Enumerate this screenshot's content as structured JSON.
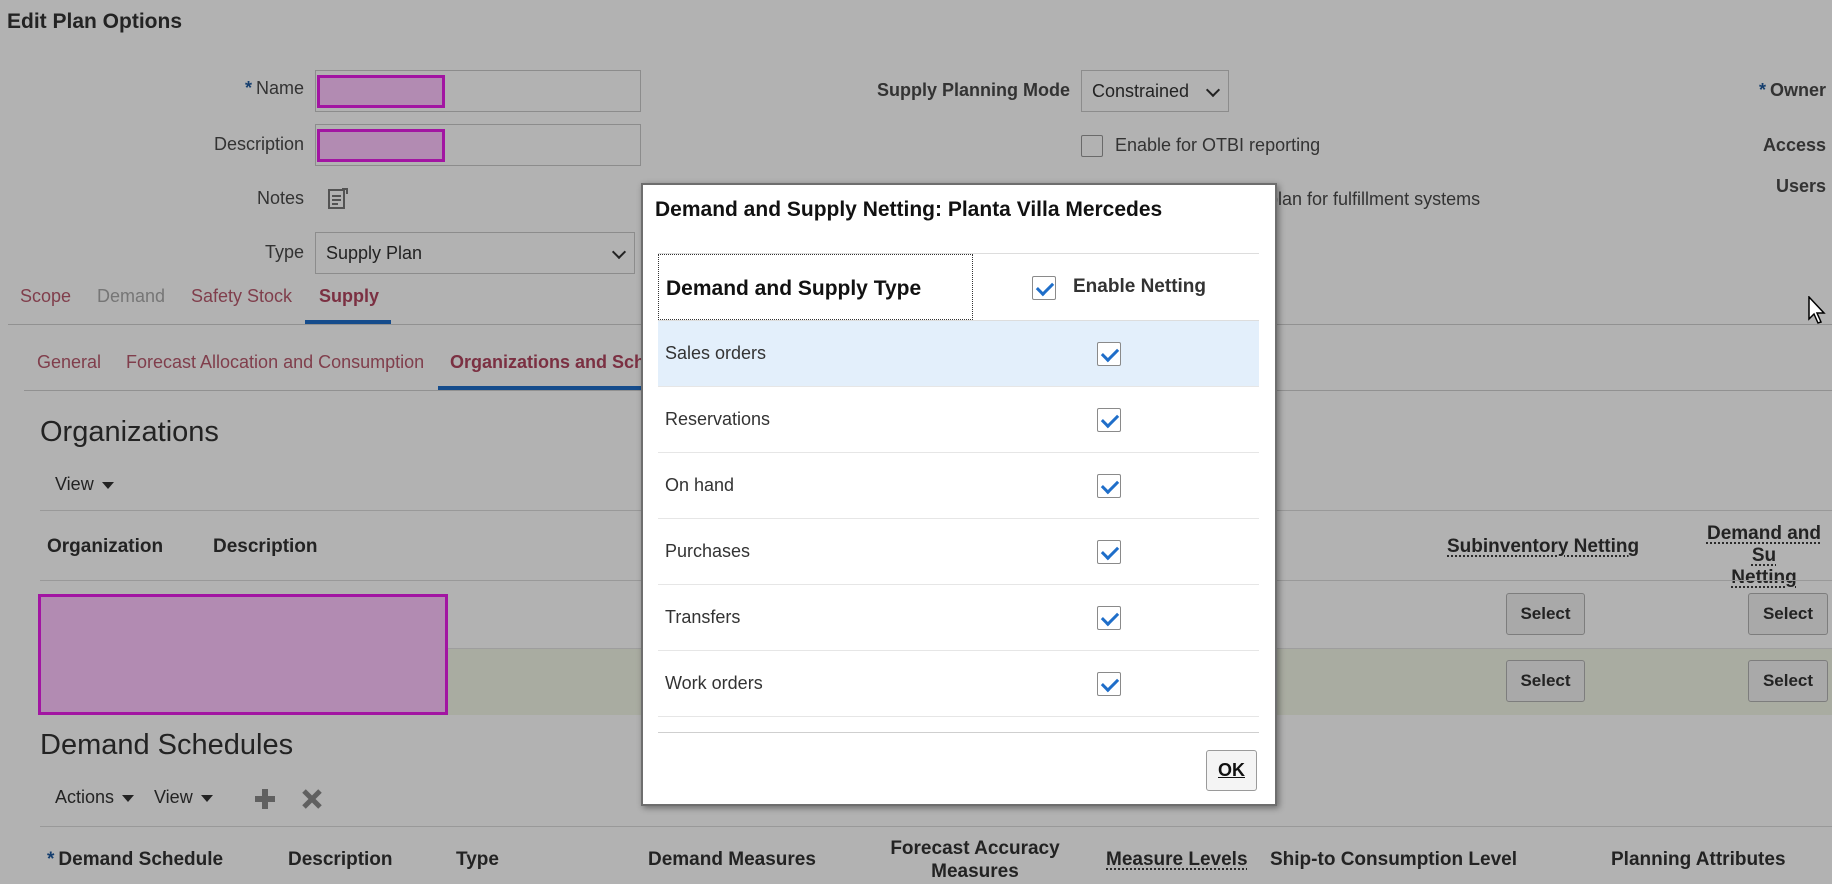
{
  "page": {
    "title": "Edit Plan Options"
  },
  "form": {
    "name_label": "Name",
    "description_label": "Description",
    "notes_label": "Notes",
    "type_label": "Type",
    "type_value": "Supply Plan",
    "supply_mode_label": "Supply Planning Mode",
    "supply_mode_value": "Constrained",
    "otbi_label": "Enable for OTBI reporting",
    "fulfillment_label": "plan for fulfillment systems",
    "owner_label": "Owner",
    "access_label": "Access",
    "users_label": "Users",
    "required_mark": "*"
  },
  "tabs": [
    "Scope",
    "Demand",
    "Safety Stock",
    "Supply"
  ],
  "subtabs": [
    "General",
    "Forecast Allocation and Consumption",
    "Organizations and Sch"
  ],
  "organizations": {
    "heading": "Organizations",
    "view_label": "View",
    "col_organization": "Organization",
    "col_description": "Description",
    "col_subinventory": "Subinventory Netting",
    "col_demand_supply_1": "Demand and Su",
    "col_demand_supply_2": "Netting",
    "select_label": "Select"
  },
  "demand_schedules": {
    "heading": "Demand Schedules",
    "actions_label": "Actions",
    "view_label": "View",
    "cols": {
      "demand_schedule": "Demand Schedule",
      "description": "Description",
      "type": "Type",
      "demand_measures": "Demand Measures",
      "forecast_accuracy_1": "Forecast Accuracy",
      "forecast_accuracy_2": "Measures",
      "measure_levels": "Measure Levels",
      "ship_to": "Ship-to Consumption Level",
      "planning_attributes": "Planning Attributes"
    }
  },
  "dialog": {
    "title": "Demand and Supply Netting: Planta Villa Mercedes",
    "col_type": "Demand and Supply Type",
    "col_enable": "Enable Netting",
    "rows": [
      {
        "label": "Sales orders"
      },
      {
        "label": "Reservations"
      },
      {
        "label": "On hand"
      },
      {
        "label": "Purchases"
      },
      {
        "label": "Transfers"
      },
      {
        "label": "Work orders"
      }
    ],
    "ok_label": "OK"
  }
}
